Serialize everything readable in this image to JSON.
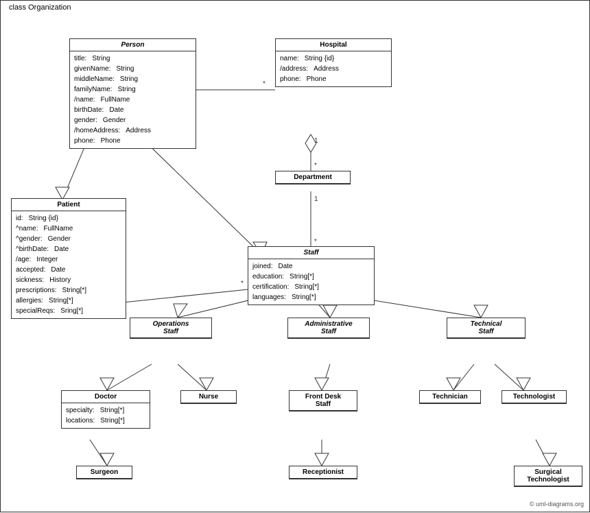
{
  "diagram": {
    "title": "class Organization",
    "classes": {
      "person": {
        "name": "Person",
        "italic": true,
        "attrs": [
          {
            "name": "title:",
            "type": "String"
          },
          {
            "name": "givenName:",
            "type": "String"
          },
          {
            "name": "middleName:",
            "type": "String"
          },
          {
            "name": "familyName:",
            "type": "String"
          },
          {
            "name": "/name:",
            "type": "FullName"
          },
          {
            "name": "birthDate:",
            "type": "Date"
          },
          {
            "name": "gender:",
            "type": "Gender"
          },
          {
            "name": "/homeAddress:",
            "type": "Address"
          },
          {
            "name": "phone:",
            "type": "Phone"
          }
        ]
      },
      "hospital": {
        "name": "Hospital",
        "italic": false,
        "attrs": [
          {
            "name": "name:",
            "type": "String {id}"
          },
          {
            "name": "/address:",
            "type": "Address"
          },
          {
            "name": "phone:",
            "type": "Phone"
          }
        ]
      },
      "patient": {
        "name": "Patient",
        "italic": false,
        "attrs": [
          {
            "name": "id:",
            "type": "String {id}"
          },
          {
            "name": "^name:",
            "type": "FullName"
          },
          {
            "name": "^gender:",
            "type": "Gender"
          },
          {
            "name": "^birthDate:",
            "type": "Date"
          },
          {
            "name": "/age:",
            "type": "Integer"
          },
          {
            "name": "accepted:",
            "type": "Date"
          },
          {
            "name": "sickness:",
            "type": "History"
          },
          {
            "name": "prescriptions:",
            "type": "String[*]"
          },
          {
            "name": "allergies:",
            "type": "String[*]"
          },
          {
            "name": "specialReqs:",
            "type": "Sring[*]"
          }
        ]
      },
      "department": {
        "name": "Department",
        "italic": false
      },
      "staff": {
        "name": "Staff",
        "italic": true,
        "attrs": [
          {
            "name": "joined:",
            "type": "Date"
          },
          {
            "name": "education:",
            "type": "String[*]"
          },
          {
            "name": "certification:",
            "type": "String[*]"
          },
          {
            "name": "languages:",
            "type": "String[*]"
          }
        ]
      },
      "operations_staff": {
        "name": "Operations Staff",
        "italic": true
      },
      "administrative_staff": {
        "name": "Administrative Staff",
        "italic": true
      },
      "technical_staff": {
        "name": "Technical Staff",
        "italic": true
      },
      "doctor": {
        "name": "Doctor",
        "italic": false,
        "attrs": [
          {
            "name": "specialty:",
            "type": "String[*]"
          },
          {
            "name": "locations:",
            "type": "String[*]"
          }
        ]
      },
      "nurse": {
        "name": "Nurse",
        "italic": false
      },
      "front_desk_staff": {
        "name": "Front Desk Staff",
        "italic": false
      },
      "technician": {
        "name": "Technician",
        "italic": false
      },
      "technologist": {
        "name": "Technologist",
        "italic": false
      },
      "surgeon": {
        "name": "Surgeon",
        "italic": false
      },
      "receptionist": {
        "name": "Receptionist",
        "italic": false
      },
      "surgical_technologist": {
        "name": "Surgical Technologist",
        "italic": false
      }
    },
    "copyright": "© uml-diagrams.org"
  }
}
